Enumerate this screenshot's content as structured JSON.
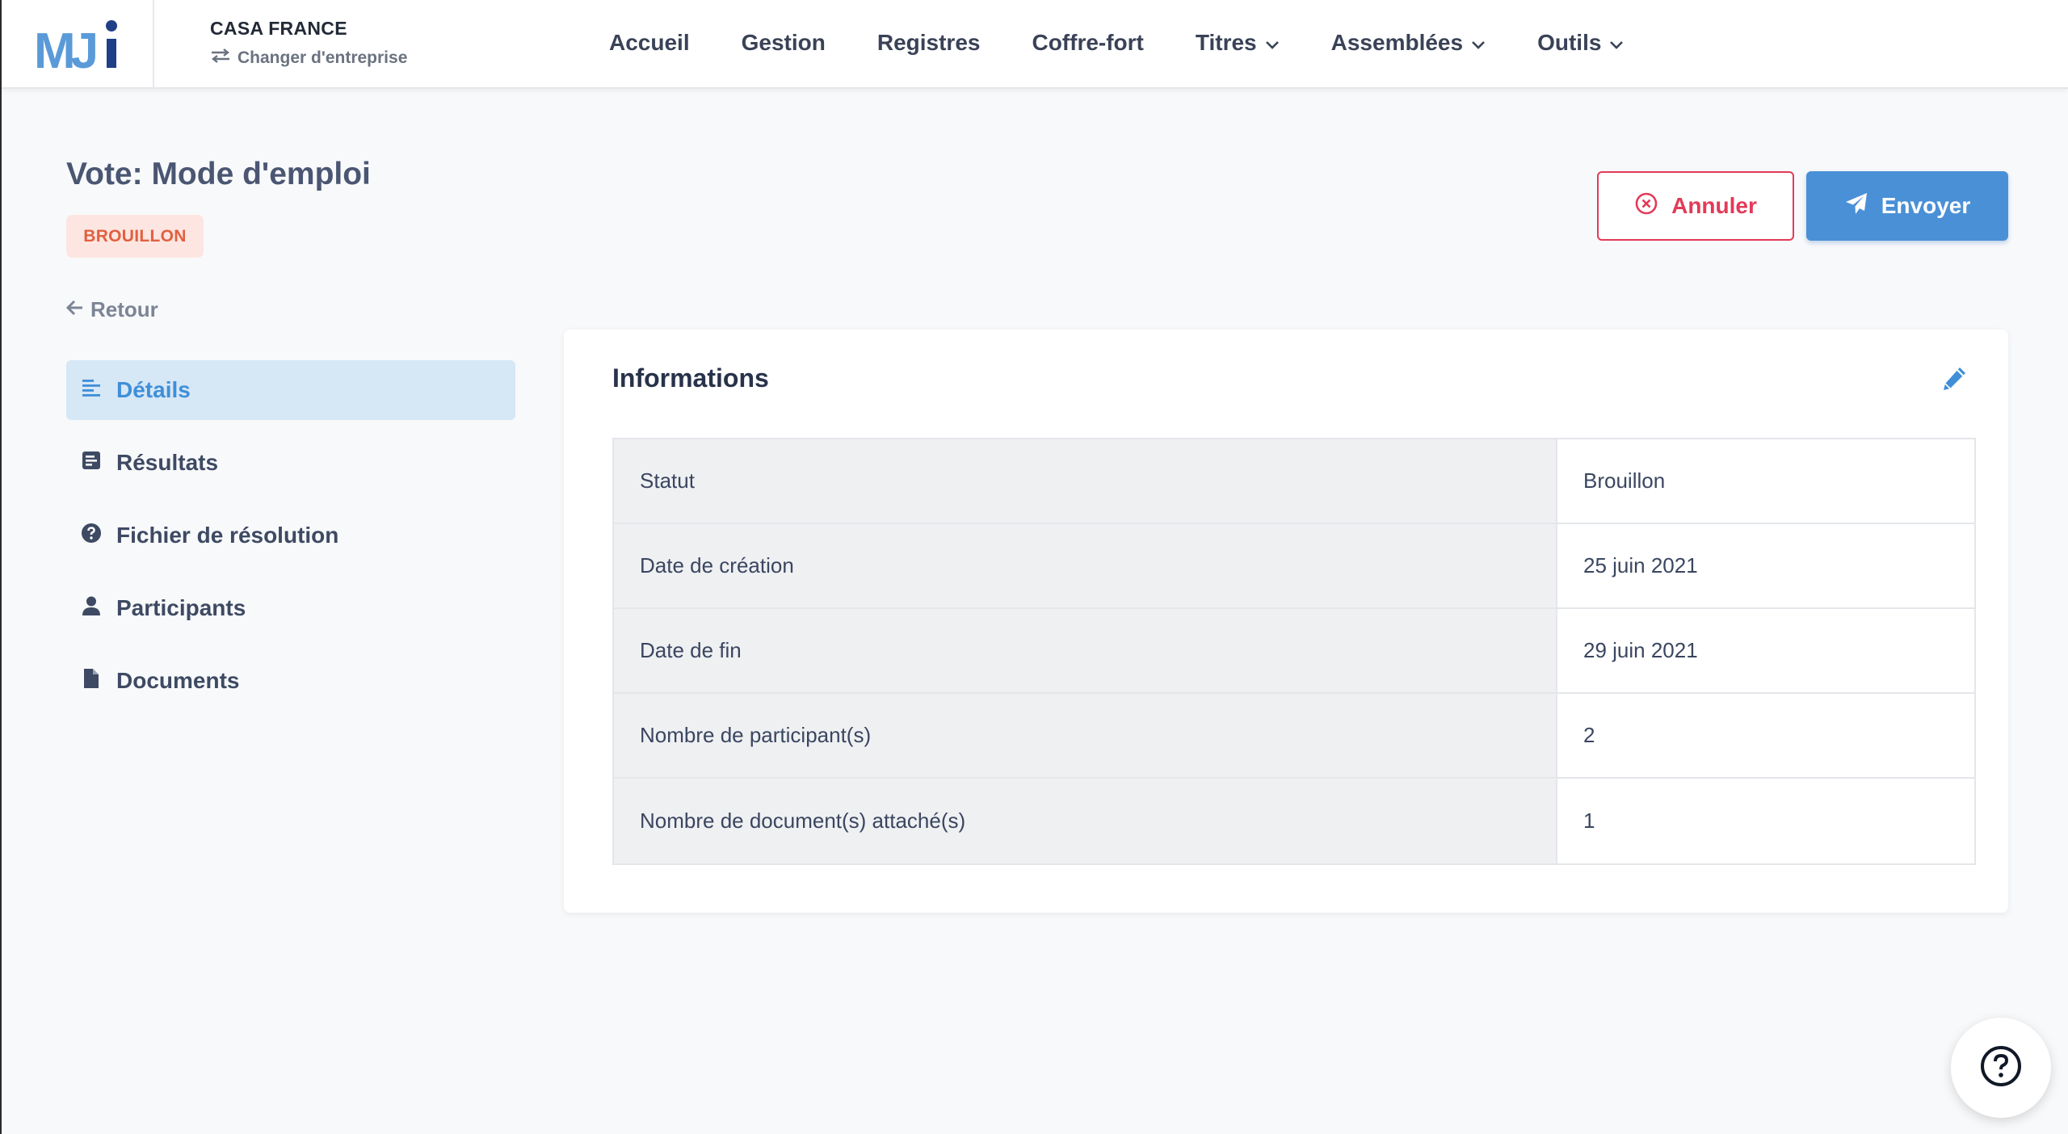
{
  "brand": {
    "logo_text": "MJi",
    "accent": "#4a90d6"
  },
  "company": {
    "name": "CASA FRANCE",
    "switch_label": "Changer d'entreprise"
  },
  "nav": {
    "items": [
      {
        "label": "Accueil",
        "dropdown": false
      },
      {
        "label": "Gestion",
        "dropdown": false
      },
      {
        "label": "Registres",
        "dropdown": false
      },
      {
        "label": "Coffre-fort",
        "dropdown": false
      },
      {
        "label": "Titres",
        "dropdown": true
      },
      {
        "label": "Assemblées",
        "dropdown": true
      },
      {
        "label": "Outils",
        "dropdown": true
      }
    ]
  },
  "page": {
    "title": "Vote: Mode d'emploi",
    "status_badge": "BROUILLON",
    "back_label": "Retour"
  },
  "actions": {
    "cancel_label": "Annuler",
    "send_label": "Envoyer"
  },
  "side_menu": {
    "items": [
      {
        "label": "Détails",
        "icon": "align-left-icon",
        "active": true
      },
      {
        "label": "Résultats",
        "icon": "poll-icon",
        "active": false
      },
      {
        "label": "Fichier de résolution",
        "icon": "question-circle-icon",
        "active": false
      },
      {
        "label": "Participants",
        "icon": "user-icon",
        "active": false
      },
      {
        "label": "Documents",
        "icon": "file-icon",
        "active": false
      }
    ]
  },
  "card": {
    "title": "Informations",
    "rows": [
      {
        "label": "Statut",
        "value": "Brouillon"
      },
      {
        "label": "Date de création",
        "value": "25 juin 2021"
      },
      {
        "label": "Date de fin",
        "value": "29 juin 2021"
      },
      {
        "label": "Nombre de participant(s)",
        "value": "2"
      },
      {
        "label": "Nombre de document(s) attaché(s)",
        "value": "1"
      }
    ]
  },
  "colors": {
    "danger": "#e33a58",
    "primary": "#4a90d6",
    "badge_bg": "#fde6e1",
    "badge_text": "#e2603f",
    "active_menu_bg": "#d6e7f6"
  }
}
